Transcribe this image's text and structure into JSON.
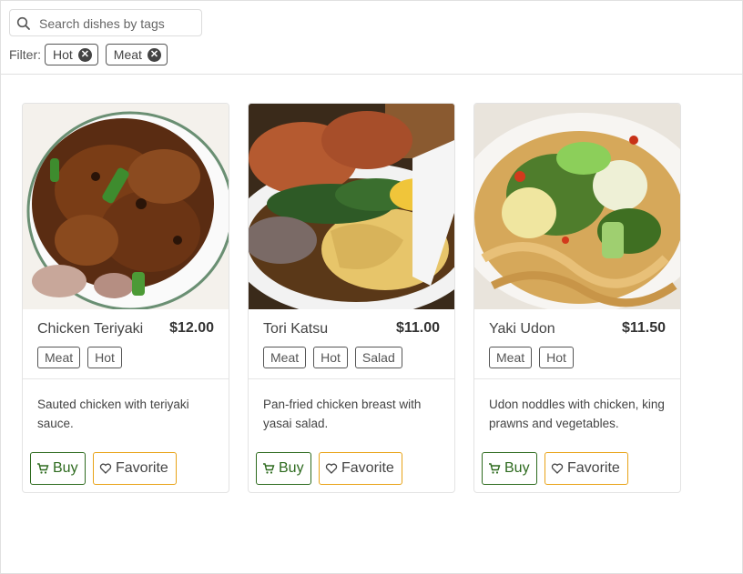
{
  "search": {
    "placeholder": "Search dishes by tags",
    "value": ""
  },
  "filter": {
    "label": "Filter:",
    "chips": [
      {
        "label": "Hot"
      },
      {
        "label": "Meat"
      }
    ]
  },
  "dishes": [
    {
      "name": "Chicken Teriyaki",
      "price": "$12.00",
      "tags": [
        "Meat",
        "Hot"
      ],
      "description": "Sauted chicken with teriyaki sauce.",
      "buy_label": "Buy",
      "favorite_label": "Favorite"
    },
    {
      "name": "Tori Katsu",
      "price": "$11.00",
      "tags": [
        "Meat",
        "Hot",
        "Salad"
      ],
      "description": "Pan-fried chicken breast with yasai salad.",
      "buy_label": "Buy",
      "favorite_label": "Favorite"
    },
    {
      "name": "Yaki Udon",
      "price": "$11.50",
      "tags": [
        "Meat",
        "Hot"
      ],
      "description": "Udon noddles with chicken, king prawns and vegetables.",
      "buy_label": "Buy",
      "favorite_label": "Favorite"
    }
  ],
  "colors": {
    "buy": "#2e6b1f",
    "favorite": "#e8a317",
    "border": "#e3e3e3"
  }
}
